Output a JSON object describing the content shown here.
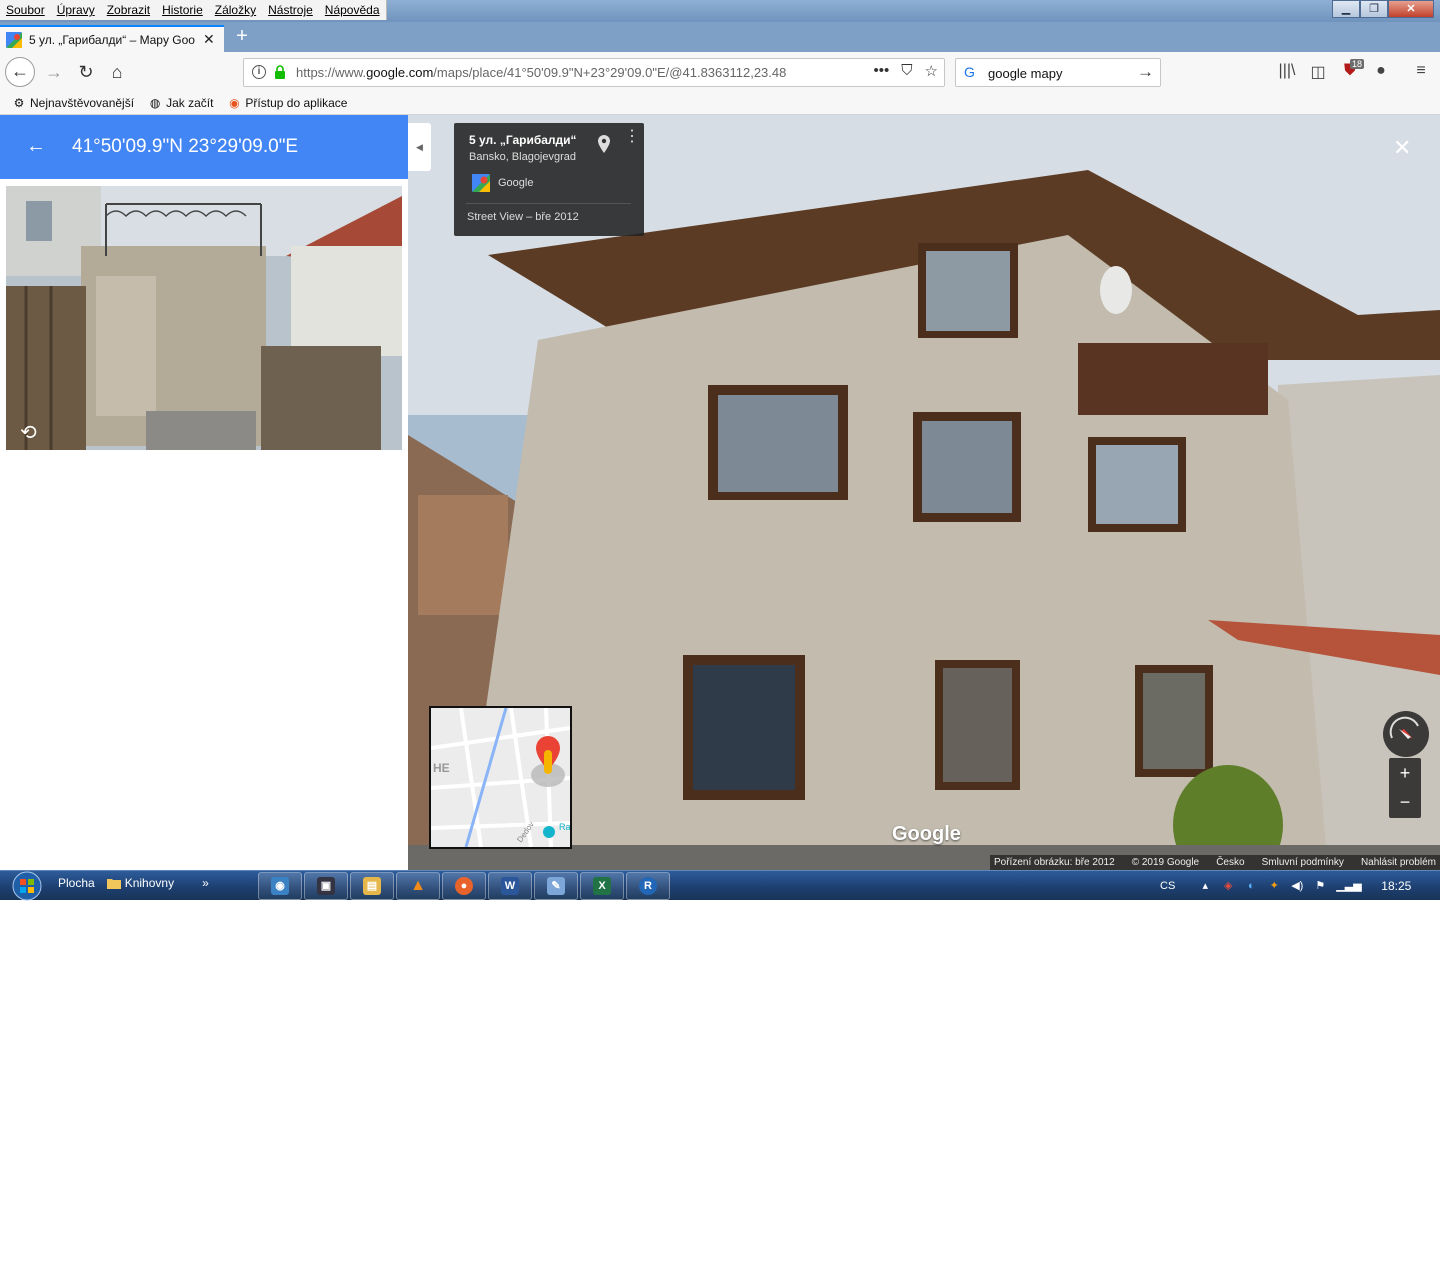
{
  "menubar": {
    "items": [
      "Soubor",
      "Úpravy",
      "Zobrazit",
      "Historie",
      "Záložky",
      "Nástroje",
      "Nápověda"
    ]
  },
  "tab": {
    "title": "5 ул. „Гарибалди“ – Mapy Goo",
    "close": "✕"
  },
  "navbar": {
    "url_prefix": "https://www.",
    "url_domain": "google.com",
    "url_rest": "/maps/place/41°50'09.9\"N+23°29'09.0\"E/@41.8363112,23.48",
    "search_text": "google mapy",
    "badge_count": "18"
  },
  "bookmarks": [
    {
      "label": "Nejnavštěvovanější",
      "icon": "gear-icon"
    },
    {
      "label": "Jak začít",
      "icon": "globe-icon"
    },
    {
      "label": "Přístup do aplikace",
      "icon": "app-icon"
    }
  ],
  "panel": {
    "coordinates": "41°50'09.9\"N 23°29'09.0\"E"
  },
  "street_view": {
    "place_title": "5 ул. „Гарибалди“",
    "place_subtitle": "Bansko, Blagojevgrad",
    "source": "Google",
    "date": "Street View – bře 2012",
    "watermark": "Google",
    "zoom_in": "+",
    "zoom_out": "−",
    "attribution": [
      "Pořízení obrázku: bře 2012",
      "© 2019 Google",
      "Česko",
      "Smluvní podmínky",
      "Nahlásit problém"
    ],
    "minimap_labels": {
      "district": "HE",
      "poi": "Ra H",
      "street": "Dedov"
    }
  },
  "taskbar": {
    "quick_launch": [
      "Plocha",
      "Knihovny"
    ],
    "more": "»",
    "apps": [
      "explorer-icon",
      "remote-icon",
      "files-icon",
      "vlc-icon",
      "firefox-icon",
      "word-icon",
      "paint-icon",
      "excel-icon",
      "r-icon"
    ],
    "language": "CS",
    "clock": "18:25"
  },
  "colors": {
    "maps_blue": "#4285f4",
    "taskbar": "#1d3e6e",
    "tab_accent": "#0a84ff"
  }
}
